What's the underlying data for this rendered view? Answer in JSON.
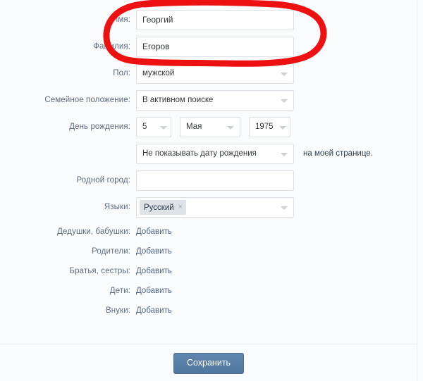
{
  "form": {
    "fields": [
      {
        "label": "Имя:",
        "type": "text",
        "value": "Георгий"
      },
      {
        "label": "Фамилия:",
        "type": "text",
        "value": "Егоров"
      },
      {
        "label": "Пол:",
        "type": "select",
        "value": "мужской"
      },
      {
        "label": "Семейное положение:",
        "type": "select",
        "value": "В активном поиске"
      }
    ],
    "birthday": {
      "label": "День рождения:",
      "day": "5",
      "month": "Мая",
      "year": "1975"
    },
    "show_date": {
      "value": "Не показывать дату рождения",
      "note": "на моей странице."
    },
    "hometown": {
      "label": "Родной город:",
      "value": "",
      "placeholder": ""
    },
    "languages": {
      "label": "Языки:",
      "tags": [
        {
          "name": "Русский",
          "remove_icon": "×"
        }
      ]
    },
    "relatives": [
      {
        "label": "Дедушки, бабушки:",
        "action": "Добавить"
      },
      {
        "label": "Родители:",
        "action": "Добавить"
      },
      {
        "label": "Братья, сестры:",
        "action": "Добавить"
      },
      {
        "label": "Дети:",
        "action": "Добавить"
      },
      {
        "label": "Внуки:",
        "action": "Добавить"
      }
    ],
    "save_label": "Сохранить"
  },
  "annotation": {
    "type": "hand-drawn-oval",
    "color": "#ee1111",
    "stroke_width": 9,
    "targets": [
      "Имя",
      "Фамилия"
    ]
  },
  "colors": {
    "page_background": "#fafbfc",
    "label_text": "#5d6c80",
    "value_text": "#33373d",
    "link_text": "#50678a",
    "field_border": "#dde1e6",
    "save_button": "#5b7ea6",
    "tag_background": "#dfe3e8",
    "annotation_red": "#ee1111"
  }
}
